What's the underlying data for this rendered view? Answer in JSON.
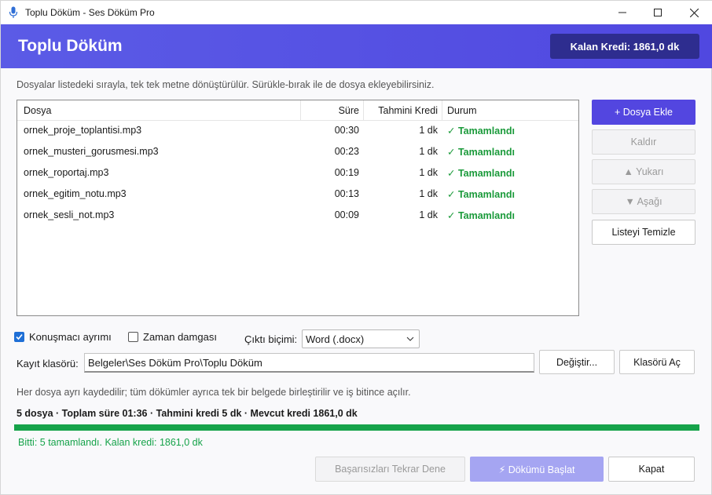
{
  "window": {
    "title": "Toplu Döküm - Ses Döküm Pro"
  },
  "header": {
    "title": "Toplu Döküm",
    "credit_badge": "Kalan Kredi: 1861,0 dk"
  },
  "hint": "Dosyalar listedeki sırayla, tek tek metne dönüştürülür. Sürükle-bırak ile de dosya ekleyebilirsiniz.",
  "table": {
    "columns": [
      "Dosya",
      "Süre",
      "Tahmini Kredi",
      "Durum"
    ],
    "rows": [
      {
        "name": "ornek_proje_toplantisi.mp3",
        "duration": "00:30",
        "credit": "1 dk",
        "status": "✓ Tamamlandı"
      },
      {
        "name": "ornek_musteri_gorusmesi.mp3",
        "duration": "00:23",
        "credit": "1 dk",
        "status": "✓ Tamamlandı"
      },
      {
        "name": "ornek_roportaj.mp3",
        "duration": "00:19",
        "credit": "1 dk",
        "status": "✓ Tamamlandı"
      },
      {
        "name": "ornek_egitim_notu.mp3",
        "duration": "00:13",
        "credit": "1 dk",
        "status": "✓ Tamamlandı"
      },
      {
        "name": "ornek_sesli_not.mp3",
        "duration": "00:09",
        "credit": "1 dk",
        "status": "✓ Tamamlandı"
      }
    ]
  },
  "side_buttons": {
    "add": "+ Dosya Ekle",
    "remove": "Kaldır",
    "up": "▲ Yukarı",
    "down": "▼ Aşağı",
    "clear": "Listeyi Temizle"
  },
  "options": {
    "speaker_separation": {
      "label": "Konuşmacı ayrımı",
      "checked": true
    },
    "timestamp": {
      "label": "Zaman damgası",
      "checked": false
    },
    "format_label": "Çıktı biçimi:",
    "format_value": "Word (.docx)"
  },
  "folder": {
    "label": "Kayıt klasörü:",
    "path": "Belgeler\\Ses Döküm Pro\\Toplu Döküm",
    "change": "Değiştir...",
    "open": "Klasörü Aç"
  },
  "info": "Her dosya ayrı kaydedilir; tüm dökümler ayrıca tek bir belgede birleştirilir ve iş bitince açılır.",
  "summary": "5 dosya  ·  Toplam süre 01:36  ·  Tahmini kredi 5 dk  ·  Mevcut kredi 1861,0 dk",
  "progress": {
    "percent": 100,
    "color": "#16a34a"
  },
  "status": "Bitti: 5 tamamlandı. Kalan kredi: 1861,0 dk",
  "bottom_buttons": {
    "retry": "Başarısızları Tekrar Dene",
    "start": "⚡ Dökümü Başlat",
    "close": "Kapat"
  },
  "colors": {
    "accent": "#5346e0",
    "header_bg": "#5b5be6",
    "badge_bg": "#2e2d8f",
    "success": "#16a34a"
  },
  "icons": {
    "app": "microphone-icon",
    "minimize": "minimize-icon",
    "maximize": "maximize-icon",
    "close": "close-icon"
  }
}
